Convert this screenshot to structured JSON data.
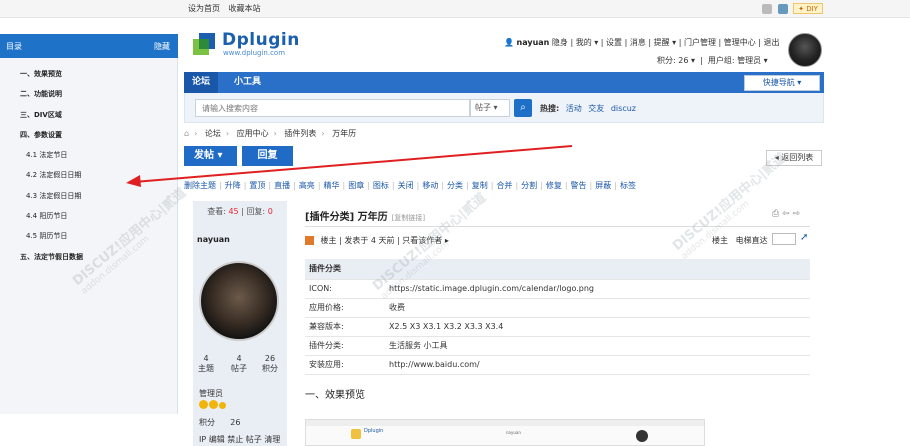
{
  "topbar": {
    "links": [
      "设为首页",
      "收藏本站"
    ],
    "diy": "DIY"
  },
  "sidebar": {
    "title": "目录",
    "hide": "隐藏",
    "items": [
      {
        "label": "一、效果预览",
        "level": 1
      },
      {
        "label": "二、功能说明",
        "level": 1
      },
      {
        "label": "三、DIV区域",
        "level": 1
      },
      {
        "label": "四、参数设置",
        "level": 1
      },
      {
        "label": "4.1 法定节日",
        "level": 2
      },
      {
        "label": "4.2 法定假日日期",
        "level": 2
      },
      {
        "label": "4.3 法定假日日期",
        "level": 2
      },
      {
        "label": "4.4 阳历节日",
        "level": 2
      },
      {
        "label": "4.5 阴历节日",
        "level": 2
      },
      {
        "label": "五、法定节假日数据",
        "level": 1
      }
    ]
  },
  "header": {
    "logo": "Dplugin",
    "logo_sub": "www.dplugin.com",
    "username": "nayuan",
    "status": "隐身",
    "links": [
      "我的",
      "设置",
      "消息",
      "提醒",
      "门户管理",
      "管理中心",
      "退出"
    ],
    "score": "积分: 26",
    "usergroup": "用户组: 管理员"
  },
  "nav": {
    "tabs": [
      "论坛",
      "小工具"
    ],
    "quick": "快捷导航"
  },
  "search": {
    "placeholder": "请输入搜索内容",
    "type": "帖子",
    "hot_label": "热搜:",
    "hot": [
      "活动",
      "交友",
      "discuz"
    ]
  },
  "breadcrumb": [
    "论坛",
    "应用中心",
    "插件列表",
    "万年历"
  ],
  "actions": {
    "post": "发帖",
    "reply": "回复",
    "back": "返回列表"
  },
  "modbar": [
    "删除主题",
    "升降",
    "置顶",
    "直播",
    "高亮",
    "精华",
    "图章",
    "图标",
    "关闭",
    "移动",
    "分类",
    "复制",
    "合并",
    "分割",
    "修复",
    "警告",
    "屏蔽",
    "标签"
  ],
  "author": {
    "views_label": "查看:",
    "views": "45",
    "replies_label": "回复:",
    "replies": "0",
    "name": "nayuan",
    "stats": [
      {
        "num": "4",
        "label": "主题"
      },
      {
        "num": "4",
        "label": "帖子"
      },
      {
        "num": "26",
        "label": "积分"
      }
    ],
    "group": "管理员",
    "score_label": "积分",
    "score": "26",
    "ip_actions": "IP 编辑 禁止 帖子 清理"
  },
  "thread": {
    "title": "[插件分类] 万年历",
    "copy_link": "[复制链接]",
    "role": "楼主",
    "posted": "发表于 4 天前",
    "only_author": "只看该作者",
    "floor": "楼主",
    "jump_label": "电梯直达"
  },
  "info": {
    "header": "插件分类",
    "rows": [
      {
        "k": "ICON:",
        "v": "https://static.image.dplugin.com/calendar/logo.png"
      },
      {
        "k": "应用价格:",
        "v": "收费"
      },
      {
        "k": "兼容版本:",
        "v": "X2.5 X3 X3.1 X3.2 X3.3 X3.4"
      },
      {
        "k": "插件分类:",
        "v": "生活服务 小工具"
      },
      {
        "k": "安装应用:",
        "v": "http://www.baidu.com/"
      }
    ]
  },
  "section_title": "一、效果预览",
  "watermark": {
    "line1": "DISCUZ!应用中心|贰道",
    "line2": "addon.dismall.com"
  },
  "colors": {
    "brand": "#1f6bc6",
    "arrow": "#e02020"
  }
}
